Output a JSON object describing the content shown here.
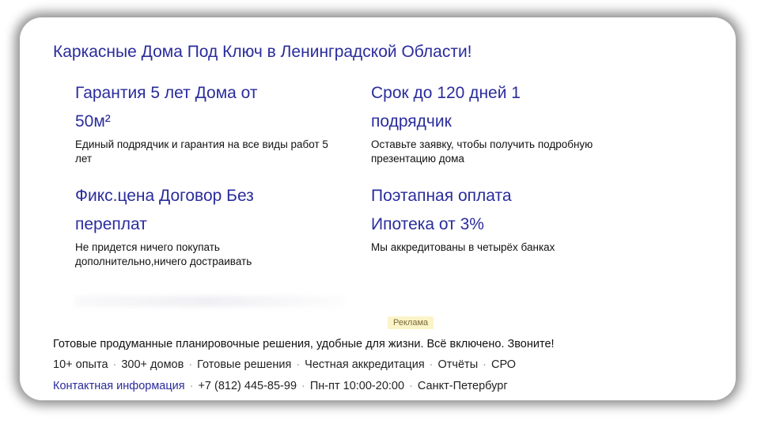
{
  "ad": {
    "title": "Каркасные Дома Под Ключ в Ленинградской Области!",
    "sitelinks": [
      {
        "title_line1": "Гарантия 5 лет Дома от",
        "title_line2": "50м²",
        "description": "Единый подрядчик и гарантия на все виды работ 5 лет"
      },
      {
        "title_line1": "Срок до 120 дней 1",
        "title_line2": "подрядчик",
        "description": "Оставьте заявку, чтобы получить подробную презентацию дома"
      },
      {
        "title_line1": "Фикс.цена Договор Без",
        "title_line2": "переплат",
        "description": "Не придется ничего покупать дополнительно,ничего достраивать"
      },
      {
        "title_line1": "Поэтапная оплата",
        "title_line2": "Ипотека от 3%",
        "description": "Мы аккредитованы в четырёх банках"
      }
    ],
    "badge": "Реклама",
    "promo_text": "Готовые продуманные планировочные решения, удобные для жизни. Всё включено. Звоните!",
    "features": [
      "10+ опыта",
      "300+ домов",
      "Готовые решения",
      "Честная аккредитация",
      "Отчёты",
      "СРО"
    ],
    "contacts": {
      "link": "Контактная информация",
      "phone": "+7 (812) 445-85-99",
      "hours": "Пн-пт 10:00-20:00",
      "city": "Санкт-Петербург"
    },
    "separator": "·"
  },
  "colors": {
    "link": "#2a2c9c",
    "badge_bg": "#fbf4c8"
  }
}
